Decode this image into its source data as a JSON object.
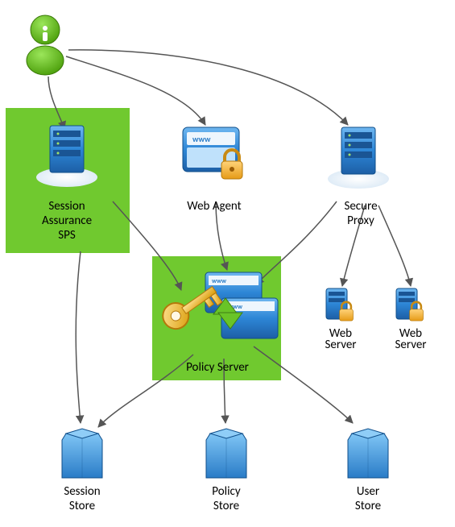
{
  "nodes": {
    "user": {
      "label": ""
    },
    "session_assurance": {
      "label1": "Session",
      "label2": "Assurance",
      "label3": "SPS"
    },
    "web_agent": {
      "label": "Web Agent"
    },
    "secure_proxy": {
      "label1": "Secure",
      "label2": "Proxy"
    },
    "policy_server": {
      "label": "Policy Server"
    },
    "web_server_1": {
      "label1": "Web",
      "label2": "Server"
    },
    "web_server_2": {
      "label1": "Web",
      "label2": "Server"
    },
    "session_store": {
      "label1": "Session",
      "label2": "Store"
    },
    "policy_store": {
      "label1": "Policy",
      "label2": "Store"
    },
    "user_store": {
      "label1": "User",
      "label2": "Store"
    }
  },
  "edges": [
    {
      "from": "user",
      "to": "session_assurance"
    },
    {
      "from": "user",
      "to": "web_agent"
    },
    {
      "from": "user",
      "to": "secure_proxy"
    },
    {
      "from": "session_assurance",
      "to": "policy_server"
    },
    {
      "from": "session_assurance",
      "to": "session_store"
    },
    {
      "from": "web_agent",
      "to": "policy_server"
    },
    {
      "from": "secure_proxy",
      "to": "policy_server"
    },
    {
      "from": "secure_proxy",
      "to": "web_server_1"
    },
    {
      "from": "secure_proxy",
      "to": "web_server_2"
    },
    {
      "from": "policy_server",
      "to": "session_store"
    },
    {
      "from": "policy_server",
      "to": "policy_store"
    },
    {
      "from": "policy_server",
      "to": "user_store"
    }
  ]
}
